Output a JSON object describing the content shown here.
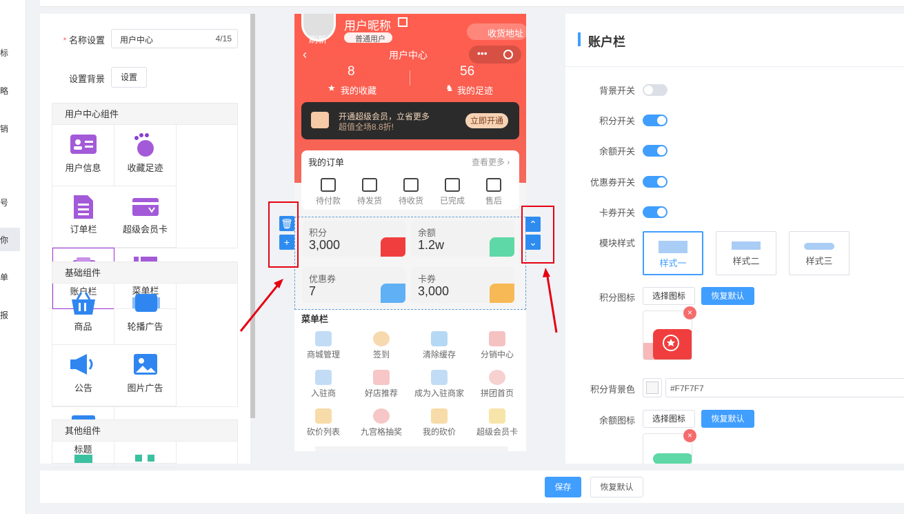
{
  "nav": {
    "items": [
      "标",
      "略",
      "销",
      "",
      "号",
      "你",
      "单",
      "报"
    ]
  },
  "left": {
    "name_label": "名称设置",
    "name_value": "用户中心",
    "name_count": "4/15",
    "bg_label": "设置背景",
    "bg_button": "设置",
    "groups": [
      {
        "title": "用户中心组件",
        "items": [
          "用户信息",
          "收藏足迹",
          "订单栏",
          "超级会员卡",
          "账户栏",
          "菜单栏"
        ]
      },
      {
        "title": "基础组件",
        "items": [
          "商品",
          "轮播广告",
          "公告",
          "图片广告",
          "标题"
        ]
      },
      {
        "title": "其他组件",
        "items": []
      }
    ]
  },
  "phone": {
    "nickname": "用户昵称",
    "refresh": "刷新",
    "level": "普通用户",
    "address": "收货地址",
    "page_title": "用户中心",
    "fav_count": "8",
    "fav_label": "我的收藏",
    "foot_count": "56",
    "foot_label": "我的足迹",
    "vip_line1": "开通超级会员，立省更多",
    "vip_line2": "超值全场8.8折!",
    "vip_button": "立即开通",
    "orders_title": "我的订单",
    "orders_more": "查看更多",
    "order_items": [
      "待付款",
      "待发货",
      "待收货",
      "已完成",
      "售后"
    ],
    "account": [
      {
        "label": "积分",
        "value": "3,000"
      },
      {
        "label": "余额",
        "value": "1.2w"
      },
      {
        "label": "优惠券",
        "value": "7"
      },
      {
        "label": "卡券",
        "value": "3,000"
      }
    ],
    "menu_title": "菜单栏",
    "menu_items": [
      "商城管理",
      "签到",
      "清除缓存",
      "分销中心",
      "入驻商",
      "好店推荐",
      "成为入驻商家",
      "拼团首页",
      "砍价列表",
      "九宫格抽奖",
      "我的砍价",
      "超级会员卡"
    ]
  },
  "right": {
    "title": "账户栏",
    "switches": [
      {
        "label": "背景开关",
        "on": false
      },
      {
        "label": "积分开关",
        "on": true
      },
      {
        "label": "余额开关",
        "on": true
      },
      {
        "label": "优惠券开关",
        "on": true
      },
      {
        "label": "卡券开关",
        "on": true
      }
    ],
    "style_label": "模块样式",
    "styles": [
      "样式一",
      "样式二",
      "样式三"
    ],
    "points_icon_label": "积分图标",
    "choose_icon": "选择图标",
    "restore_default": "恢复默认",
    "points_bg_label": "积分背景色",
    "points_bg_value": "#F7F7F7",
    "balance_icon_label": "余额图标",
    "choose_icon2": "选择图标",
    "restore_default2": "恢复默认"
  },
  "footer": {
    "save": "保存",
    "reset": "恢复默认"
  },
  "colors": {
    "accent": "#409eff",
    "phone_red": "#ff5e4f",
    "highlight": "#e60012",
    "selected": "#9b2bd4"
  }
}
